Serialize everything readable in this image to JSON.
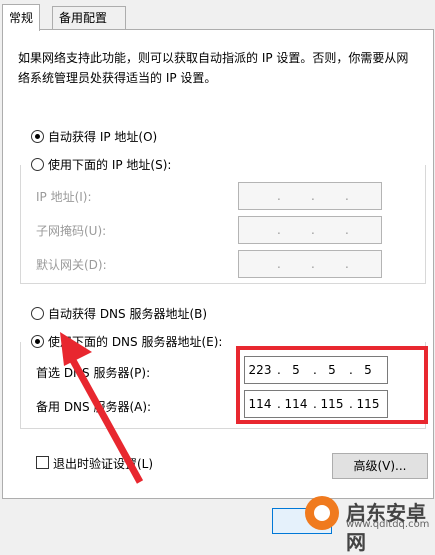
{
  "tabs": {
    "general": "常规",
    "alternate": "备用配置"
  },
  "description": "如果网络支持此功能，则可以获取自动指派的 IP 设置。否则，你需要从网络系统管理员处获得适当的 IP 设置。",
  "ip_section": {
    "auto_radio": "自动获得 IP 地址(O)",
    "manual_radio": "使用下面的 IP 地址(S):",
    "ip_label": "IP 地址(I):",
    "mask_label": "子网掩码(U):",
    "gateway_label": "默认网关(D):",
    "auto_selected": true
  },
  "dns_section": {
    "auto_radio": "自动获得 DNS 服务器地址(B)",
    "manual_radio": "使用下面的 DNS 服务器地址(E):",
    "preferred_label": "首选 DNS 服务器(P):",
    "alternate_label": "备用 DNS 服务器(A):",
    "preferred": [
      "223",
      "5",
      "5",
      "5"
    ],
    "alternate": [
      "114",
      "114",
      "115",
      "115"
    ],
    "manual_selected": true
  },
  "validate_checkbox": "退出时验证设置(L)",
  "advanced_button": "高级(V)...",
  "watermark": {
    "name": "启东安卓网",
    "url": "www.qdltdq.com"
  },
  "colors": {
    "highlight": "#e8272f",
    "watermark_logo": "#f07a1e"
  }
}
